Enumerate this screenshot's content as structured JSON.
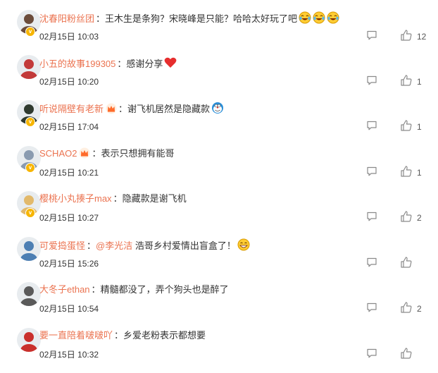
{
  "comments": [
    {
      "user": "沈春阳粉丝团",
      "mention": "",
      "sep": "：",
      "text": "王木生是条狗？宋晓峰是只能？哈哈太好玩了吧",
      "emoji": [
        "laugh-cry",
        "laugh-cry",
        "laugh-cry"
      ],
      "time": "02月15日 10:03",
      "likes": "12",
      "verified": true,
      "crown": false,
      "avatar_color": "#6b4c3b"
    },
    {
      "user": "小五的故事199305",
      "mention": "",
      "sep": "：",
      "text": "感谢分享",
      "emoji": [
        "heart"
      ],
      "time": "02月15日 10:20",
      "likes": "1",
      "verified": false,
      "crown": false,
      "avatar_color": "#c23a3a"
    },
    {
      "user": "听说隔壁有老新",
      "mention": "",
      "sep": "：",
      "text": "谢飞机居然是隐藏款",
      "emoji": [
        "doraemon"
      ],
      "time": "02月15日 17:04",
      "likes": "1",
      "verified": true,
      "crown": true,
      "avatar_color": "#2f3a2f"
    },
    {
      "user": "SCHAO2",
      "mention": "",
      "sep": "：",
      "text": "表示只想拥有能哥",
      "emoji": [],
      "time": "02月15日 10:21",
      "likes": "1",
      "verified": true,
      "crown": true,
      "avatar_color": "#8a9bb0"
    },
    {
      "user": "樱桃小丸揍子max",
      "mention": "",
      "sep": "：",
      "text": "隐藏款是谢飞机",
      "emoji": [],
      "time": "02月15日 10:27",
      "likes": "2",
      "verified": true,
      "crown": false,
      "avatar_color": "#e2b96b"
    },
    {
      "user": "可爱捣蛋怪",
      "mention": "@李光洁",
      "sep": "：",
      "text": " 浩哥乡村爱情出盲盒了！",
      "emoji": [
        "grin"
      ],
      "time": "02月15日 15:26",
      "likes": "",
      "verified": false,
      "crown": false,
      "avatar_color": "#4d7fb3"
    },
    {
      "user": "大冬子ethan",
      "mention": "",
      "sep": "：",
      "text": "精髓都没了，弄个狗头也是醉了",
      "emoji": [],
      "time": "02月15日 10:54",
      "likes": "2",
      "verified": false,
      "crown": false,
      "avatar_color": "#5a5a5a"
    },
    {
      "user": "要一直陪着啵啵吖",
      "mention": "",
      "sep": "：",
      "text": "乡爱老粉表示都想要",
      "emoji": [],
      "time": "02月15日 10:32",
      "likes": "",
      "verified": false,
      "crown": false,
      "avatar_color": "#c9302c"
    }
  ],
  "icons": {
    "reply": "comment-icon",
    "like": "thumbs-up-icon",
    "verified": "v-badge-icon",
    "crown": "vip-crown-icon"
  },
  "colors": {
    "username": "#eb7350",
    "text": "#333333",
    "badge": "#f7b500"
  }
}
